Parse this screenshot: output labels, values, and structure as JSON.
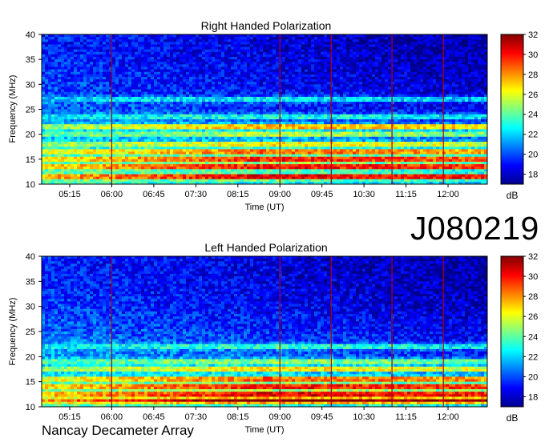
{
  "identifier": "J080219",
  "instrument": "Nancay Decameter Array",
  "chart_data": [
    {
      "type": "heatmap",
      "title": "Right Handed Polarization",
      "xlabel": "Time (UT)",
      "ylabel": "Frequency (MHz)",
      "x_ticks": [
        "05:15",
        "06:00",
        "06:45",
        "07:30",
        "08:15",
        "09:00",
        "09:45",
        "10:30",
        "11:15",
        "12:00"
      ],
      "y_ticks": [
        10,
        15,
        20,
        25,
        30,
        35,
        40
      ],
      "ylim": [
        10,
        40
      ],
      "xlim_hours": [
        4.75,
        12.7
      ],
      "colorbar": {
        "label": "dB",
        "ticks": [
          18,
          20,
          22,
          24,
          26,
          28,
          30,
          32
        ],
        "range": [
          17,
          32
        ],
        "colormap": "jet"
      },
      "grid": false,
      "bright_bands_mhz": [
        {
          "freq": 11.5,
          "db": 31
        },
        {
          "freq": 13.5,
          "db": 31
        },
        {
          "freq": 15,
          "db": 31
        },
        {
          "freq": 16.5,
          "db": 30
        },
        {
          "freq": 18,
          "db": 28
        },
        {
          "freq": 20,
          "db": 27
        },
        {
          "freq": 21.5,
          "db": 30
        },
        {
          "freq": 23.5,
          "db": 25
        },
        {
          "freq": 27,
          "db": 25
        }
      ],
      "vertical_markers_ut": [
        "06:00",
        "09:00",
        "09:55",
        "11:00",
        "11:55"
      ]
    },
    {
      "type": "heatmap",
      "title": "Left Handed Polarization",
      "xlabel": "Time (UT)",
      "ylabel": "Frequency (MHz)",
      "x_ticks": [
        "05:15",
        "06:00",
        "06:45",
        "07:30",
        "08:15",
        "09:00",
        "09:45",
        "10:30",
        "11:15",
        "12:00"
      ],
      "y_ticks": [
        10,
        15,
        20,
        25,
        30,
        35,
        40
      ],
      "ylim": [
        10,
        40
      ],
      "xlim_hours": [
        4.75,
        12.7
      ],
      "colorbar": {
        "label": "dB",
        "ticks": [
          18,
          20,
          22,
          24,
          26,
          28,
          30,
          32
        ],
        "range": [
          17,
          32
        ],
        "colormap": "jet"
      },
      "grid": false,
      "bright_bands_mhz": [
        {
          "freq": 11.2,
          "db": 31
        },
        {
          "freq": 12.5,
          "db": 31
        },
        {
          "freq": 14,
          "db": 31
        },
        {
          "freq": 15.5,
          "db": 30
        },
        {
          "freq": 17.5,
          "db": 28
        },
        {
          "freq": 19,
          "db": 26
        },
        {
          "freq": 22,
          "db": 25
        }
      ],
      "vertical_markers_ut": [
        "06:00",
        "09:00",
        "09:55",
        "11:00",
        "11:55"
      ]
    }
  ]
}
